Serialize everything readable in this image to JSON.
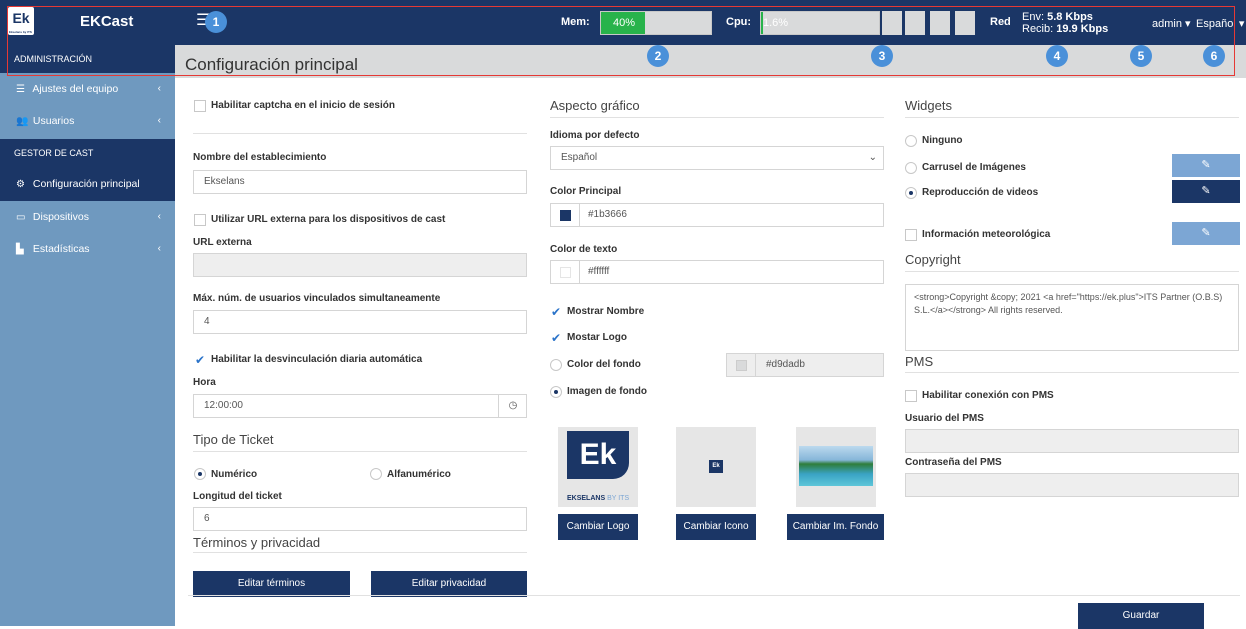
{
  "app": {
    "logo_text": "Ek",
    "logo_sub": "Ekselans by ITS",
    "brand": "EKCast"
  },
  "topbar": {
    "mem_label": "Mem:",
    "mem_text": "40%",
    "mem_value": 40,
    "cpu_label": "Cpu:",
    "cpu_text": "1.6%",
    "cpu_value": 1.6,
    "net_label": "Red",
    "env_label": "Env:",
    "env_value": "5.8 Kbps",
    "recib_label": "Recib:",
    "recib_value": "19.9 Kbps",
    "user": "admin",
    "language": "Español",
    "markers": [
      "1",
      "2",
      "3",
      "4",
      "5",
      "6"
    ]
  },
  "sidebar": {
    "section_admin": "ADMINISTRACIÓN",
    "items_admin": [
      {
        "label": "Ajustes del equipo",
        "icon": "list-icon"
      },
      {
        "label": "Usuarios",
        "icon": "users-icon"
      }
    ],
    "section_cast": "GESTOR DE CAST",
    "items_cast": [
      {
        "label": "Configuración principal",
        "icon": "cogs-icon"
      },
      {
        "label": "Dispositivos",
        "icon": "devices-icon"
      },
      {
        "label": "Estadísticas",
        "icon": "chart-icon"
      }
    ]
  },
  "page": {
    "title": "Configuración principal"
  },
  "col1": {
    "captcha_label": "Habilitar captcha en el inicio de sesión",
    "name_label": "Nombre del establecimiento",
    "name_value": "Ekselans",
    "external_url_check": "Utilizar URL externa para los dispositivos de cast",
    "external_url_label": "URL externa",
    "max_users_label": "Máx. núm. de usuarios vinculados simultaneamente",
    "max_users_value": "4",
    "auto_unlink_label": "Habilitar la desvinculación diaria automática",
    "hour_label": "Hora",
    "hour_value": "12:00:00",
    "ticket_title": "Tipo de Ticket",
    "ticket_numeric": "Numérico",
    "ticket_alpha": "Alfanumérico",
    "ticket_length_label": "Longitud del ticket",
    "ticket_length_value": "6",
    "terms_title": "Términos y privacidad",
    "edit_terms": "Editar términos",
    "edit_privacy": "Editar privacidad"
  },
  "col2": {
    "title": "Aspecto gráfico",
    "lang_label": "Idioma por defecto",
    "lang_value": "Español",
    "main_color_label": "Color Principal",
    "main_color_value": "#1b3666",
    "text_color_label": "Color de texto",
    "text_color_value": "#ffffff",
    "show_name": "Mostrar Nombre",
    "show_logo": "Mostar Logo",
    "bg_color_label": "Color del fondo",
    "bg_color_value": "#d9dadb",
    "bg_image_label": "Imagen de fondo",
    "logo_big": "Ek",
    "logo_caption_a": "EKSELANS",
    "logo_caption_b": "BY ITS",
    "icon_text": "Ek",
    "change_logo": "Cambiar Logo",
    "change_icon": "Cambiar Icono",
    "change_bg": "Cambiar Im. Fondo"
  },
  "col3": {
    "widgets_title": "Widgets",
    "w_none": "Ninguno",
    "w_carousel": "Carrusel de Imágenes",
    "w_video": "Reproducción de videos",
    "w_weather": "Información meteorológica",
    "copyright_title": "Copyright",
    "copyright_text": "<strong>Copyright &copy; 2021 <a href=\"https://ek.plus\">ITS Partner (O.B.S) S.L.</a></strong> All rights reserved.",
    "pms_title": "PMS",
    "pms_enable": "Habilitar conexión con PMS",
    "pms_user_label": "Usuario del PMS",
    "pms_pass_label": "Contraseña del PMS"
  },
  "footer": {
    "save": "Guardar"
  },
  "colors": {
    "brand": "#1b3666",
    "sidebar": "#6f99bf",
    "header": "#d9dadb",
    "mem_fill": "#28b34b",
    "marker": "#4a90d9",
    "highlight": "#e53935"
  }
}
